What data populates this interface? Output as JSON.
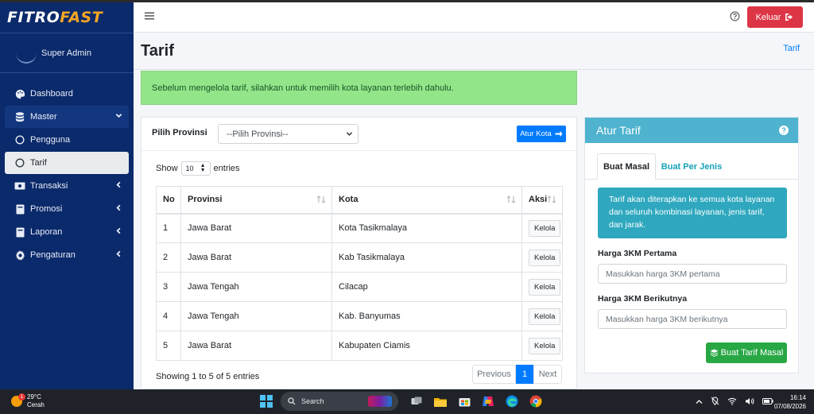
{
  "brand": {
    "part1": "FITRO",
    "part2": "FAST"
  },
  "user": {
    "name": "Super Admin"
  },
  "sidebar": {
    "items": [
      {
        "label": "Dashboard",
        "icon": "palette-icon"
      },
      {
        "label": "Master",
        "icon": "database-icon"
      },
      {
        "label": "Pengguna",
        "icon": "circle-icon"
      },
      {
        "label": "Tarif",
        "icon": "circle-icon"
      },
      {
        "label": "Transaksi",
        "icon": "money-icon"
      },
      {
        "label": "Promosi",
        "icon": "book-icon"
      },
      {
        "label": "Laporan",
        "icon": "book-icon"
      },
      {
        "label": "Pengaturan",
        "icon": "gear-icon"
      }
    ]
  },
  "header": {
    "logout_label": "Keluar"
  },
  "page": {
    "title": "Tarif",
    "breadcrumb": "Tarif",
    "alert": "Sebelum mengelola tarif, silahkan untuk memilih kota layanan terlebih dahulu."
  },
  "filter": {
    "province_label": "Pilih Provinsi",
    "province_value": "--Pilih Provinsi--",
    "atur_kota_label": "Atur Kota"
  },
  "table": {
    "show_label": "Show",
    "entries_value": "10",
    "entries_label": "entries",
    "headers": [
      "No",
      "Provinsi",
      "Kota",
      "Aksi"
    ],
    "rows": [
      {
        "no": "1",
        "provinsi": "Jawa Barat",
        "kota": "Kota Tasikmalaya",
        "aksi": "Kelola"
      },
      {
        "no": "2",
        "provinsi": "Jawa Barat",
        "kota": "Kab Tasikmalaya",
        "aksi": "Kelola"
      },
      {
        "no": "3",
        "provinsi": "Jawa Tengah",
        "kota": "Cilacap",
        "aksi": "Kelola"
      },
      {
        "no": "4",
        "provinsi": "Jawa Tengah",
        "kota": "Kab. Banyumas",
        "aksi": "Kelola"
      },
      {
        "no": "5",
        "provinsi": "Jawa Barat",
        "kota": "Kabupaten Ciamis",
        "aksi": "Kelola"
      }
    ],
    "info": "Showing 1 to 5 of 5 entries",
    "pagination": {
      "previous": "Previous",
      "current": "1",
      "next": "Next"
    }
  },
  "tarif_panel": {
    "title": "Atur Tarif",
    "tabs": [
      "Buat Masal",
      "Buat Per Jenis"
    ],
    "info": "Tarif akan diterapkan ke semua kota layanan dan seluruh kombinasi layanan, jenis tarif, dan jarak.",
    "field1_label": "Harga 3KM Pertama",
    "field1_placeholder": "Masukkan harga 3KM pertama",
    "field2_label": "Harga 3KM Berikutnya",
    "field2_placeholder": "Masukkan harga 3KM berikutnya",
    "submit_label": "Buat Tarif Masal"
  },
  "taskbar": {
    "temperature": "29°C",
    "condition": "Cerah",
    "weather_badge": "1",
    "search_label": "Search",
    "time": "16:14",
    "date": "07/08/2026"
  }
}
